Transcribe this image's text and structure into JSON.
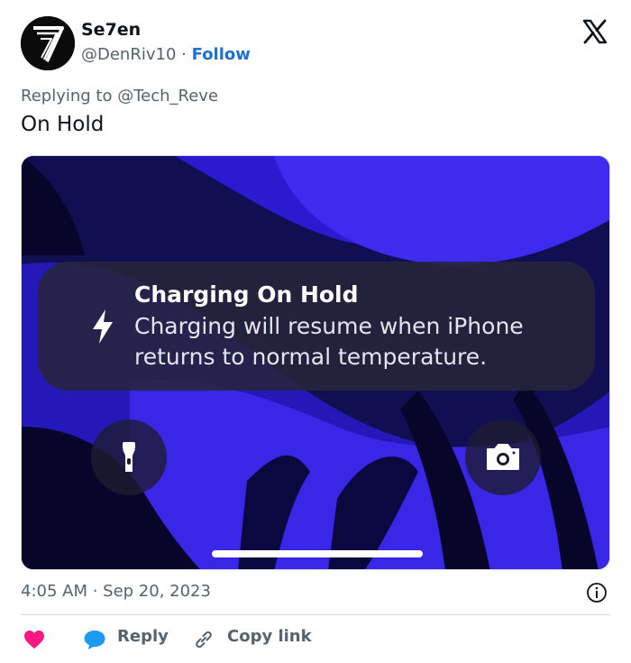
{
  "author": {
    "display_name": "Se7en",
    "handle": "@DenRiv10",
    "separator": "·",
    "follow_label": "Follow",
    "avatar_glyph": "7"
  },
  "tweet": {
    "replying_to": "Replying to @Tech_Reve",
    "text": "On Hold",
    "timestamp": "4:05 AM · Sep 20, 2023"
  },
  "media": {
    "notification": {
      "title": "Charging On Hold",
      "body": "Charging will resume when iPhone returns to normal temperature.",
      "icon": "bolt-icon"
    },
    "buttons": [
      "flashlight-icon",
      "camera-icon"
    ],
    "wallpaper_colors": {
      "deep": "#07052a",
      "violet": "#3a25e0",
      "indigo": "#1a1590"
    }
  },
  "actions": {
    "reply_label": "Reply",
    "copy_link_label": "Copy link",
    "like_icon": "heart-icon",
    "reply_icon": "reply-bubble-icon",
    "link_icon": "link-icon"
  },
  "colors": {
    "follow": "#1d6fd6",
    "heart": "#f91880",
    "reply_bubble": "#1d9bf0",
    "muted": "#536471"
  }
}
